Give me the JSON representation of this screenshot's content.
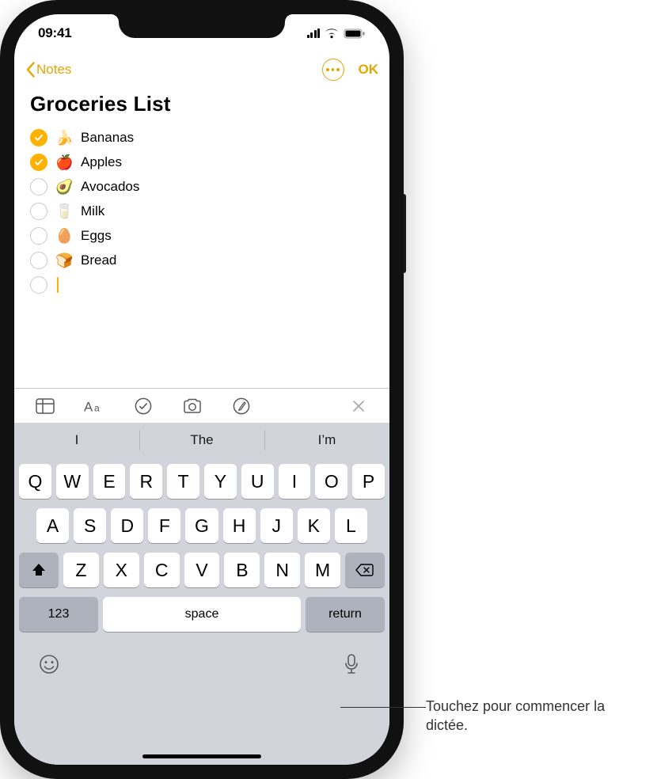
{
  "status": {
    "time": "09:41"
  },
  "nav": {
    "back_label": "Notes",
    "done_label": "OK"
  },
  "note": {
    "title": "Groceries List",
    "items": [
      {
        "emoji": "🍌",
        "label": "Bananas",
        "checked": true
      },
      {
        "emoji": "🍎",
        "label": "Apples",
        "checked": true
      },
      {
        "emoji": "🥑",
        "label": "Avocados",
        "checked": false
      },
      {
        "emoji": "🥛",
        "label": "Milk",
        "checked": false
      },
      {
        "emoji": "🥚",
        "label": "Eggs",
        "checked": false
      },
      {
        "emoji": "🍞",
        "label": "Bread",
        "checked": false
      }
    ]
  },
  "predictions": [
    "I",
    "The",
    "I’m"
  ],
  "keyboard": {
    "row1": [
      "Q",
      "W",
      "E",
      "R",
      "T",
      "Y",
      "U",
      "I",
      "O",
      "P"
    ],
    "row2": [
      "A",
      "S",
      "D",
      "F",
      "G",
      "H",
      "J",
      "K",
      "L"
    ],
    "row3": [
      "Z",
      "X",
      "C",
      "V",
      "B",
      "N",
      "M"
    ],
    "num_label": "123",
    "space_label": "space",
    "return_label": "return"
  },
  "callout": {
    "text": "Touchez pour commencer la dictée."
  }
}
